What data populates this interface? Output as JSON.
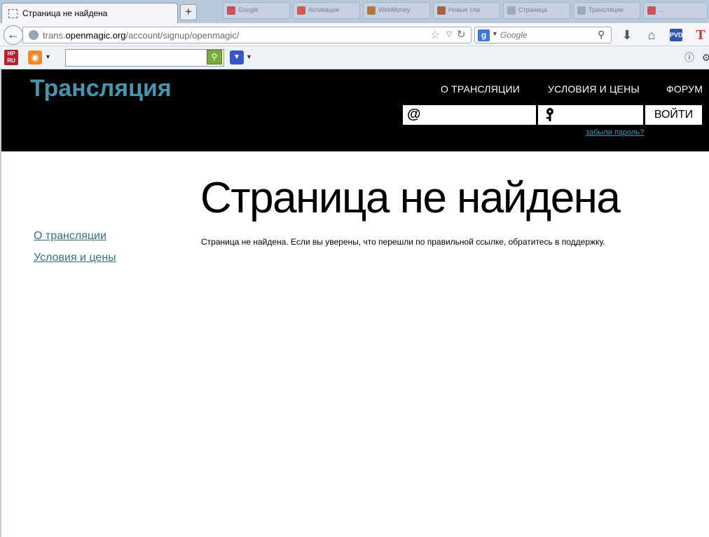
{
  "browser": {
    "active_tab": {
      "title": "Страница не найдена"
    },
    "new_tab_label": "+",
    "background_tabs": [
      {
        "title": "Google",
        "color": "#cf3d3d"
      },
      {
        "title": "Активация",
        "color": "#d9463c"
      },
      {
        "title": "WebMoney",
        "color": "#b06a2a"
      },
      {
        "title": "Новые сла",
        "color": "#a0522d"
      },
      {
        "title": "Страница",
        "color": "#9aa6b3"
      },
      {
        "title": "Трансляции",
        "color": "#9aa6b3"
      },
      {
        "title": "...",
        "color": "#c44"
      }
    ],
    "url": {
      "prefix": "trans.",
      "host": "openmagic.org",
      "path": "/account/signup/openmagic/"
    },
    "search": {
      "engine_icon": "g",
      "placeholder": "Google"
    },
    "icons": {
      "back": "back-arrow-icon",
      "globe": "globe-icon",
      "star": "star-icon",
      "reload": "reload-icon",
      "download": "download-icon",
      "home": "home-icon"
    },
    "bookmarks_bar": {
      "hp_label": "HP RU",
      "search_value": ""
    }
  },
  "site": {
    "logo": "Трансляция",
    "nav": [
      {
        "label": "О ТРАНСЛЯЦИИ"
      },
      {
        "label": "УСЛОВИЯ И ЦЕНЫ"
      },
      {
        "label": "ФОРУМ"
      }
    ],
    "login": {
      "email_glyph": "@",
      "email_value": "",
      "password_glyph": "key",
      "password_value": "",
      "submit_label": "ВОЙТИ",
      "forgot_label": "забыли пароль?"
    },
    "sidebar": [
      {
        "label": "О трансляции"
      },
      {
        "label": "Условия и цены"
      }
    ],
    "main": {
      "heading": "Страница не найдена",
      "message": "Страница не найдена. Если вы уверены, что перешли по правильной ссылке, обратитесь в поддержку."
    },
    "colors": {
      "accent": "#4a93ad",
      "header_bg": "#000000"
    }
  }
}
